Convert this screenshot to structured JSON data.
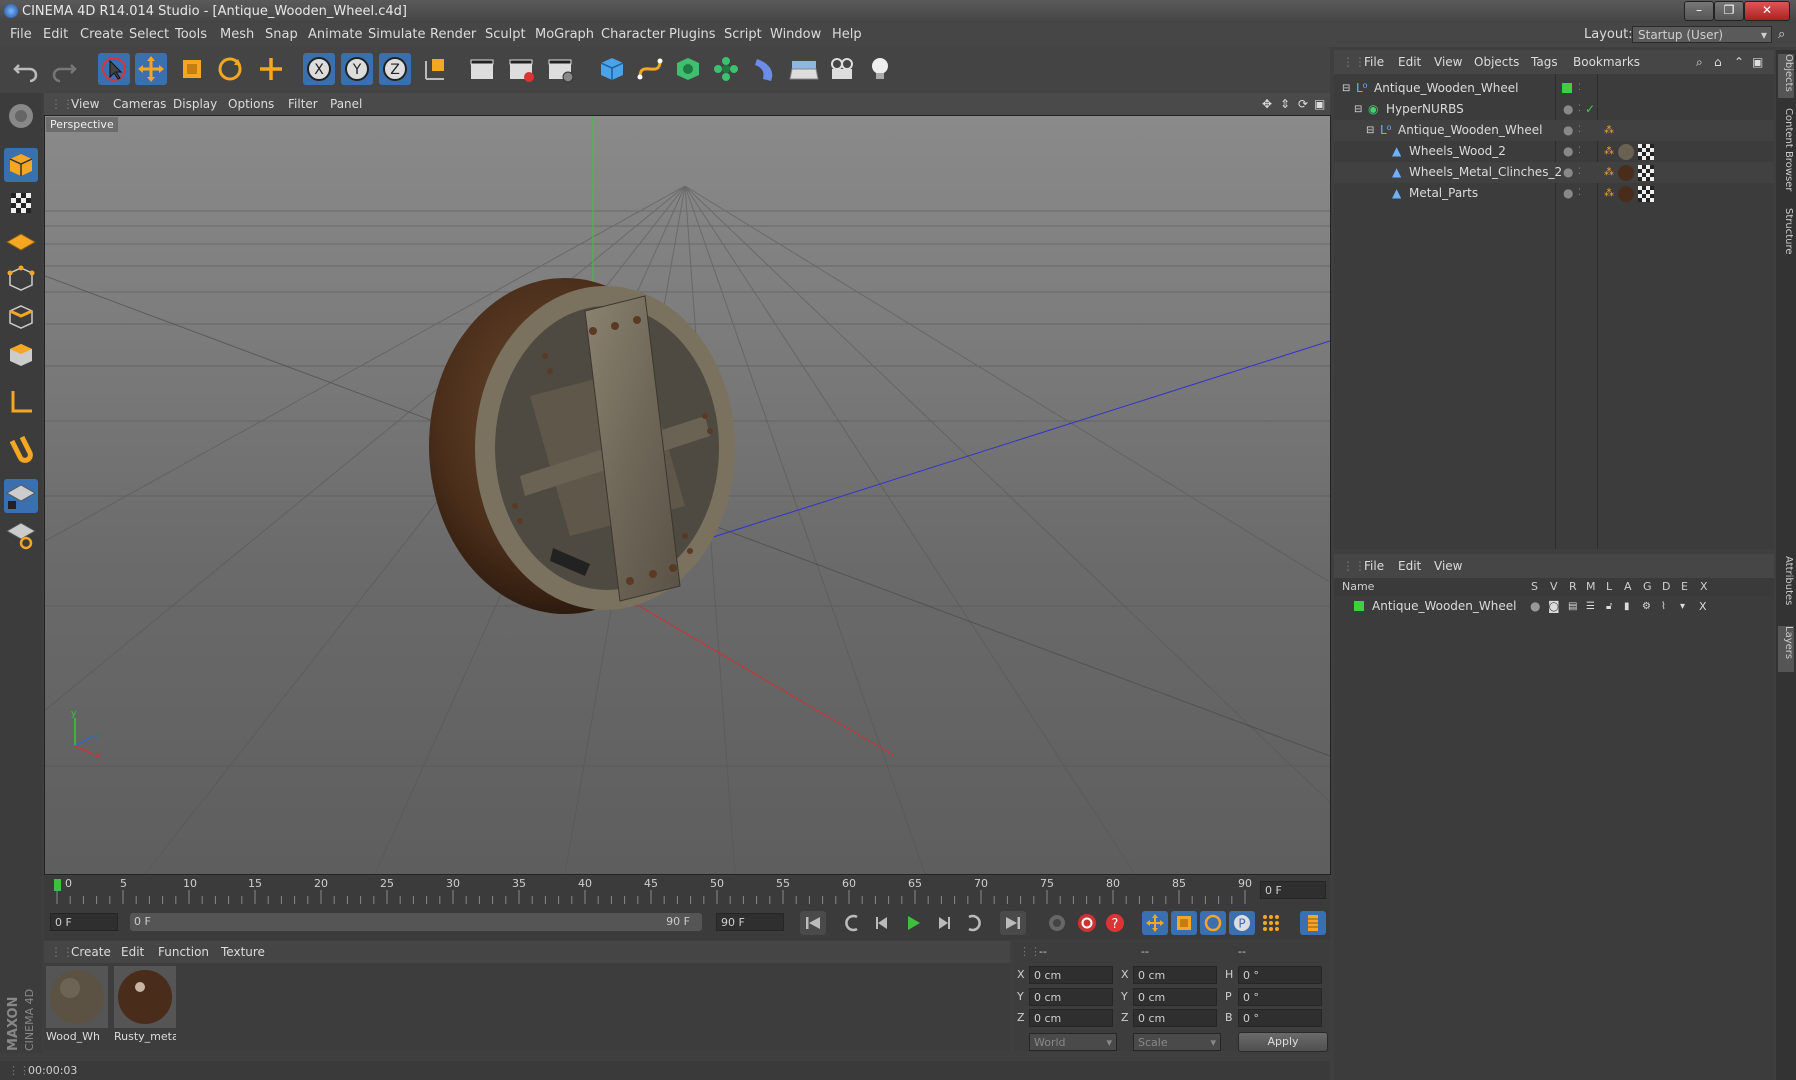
{
  "window": {
    "title": "CINEMA 4D R14.014 Studio - [Antique_Wooden_Wheel.c4d]",
    "layout_label": "Layout:",
    "layout_value": "Startup (User)"
  },
  "menubar": [
    "File",
    "Edit",
    "Create",
    "Select",
    "Tools",
    "Mesh",
    "Snap",
    "Animate",
    "Simulate",
    "Render",
    "Sculpt",
    "MoGraph",
    "Character",
    "Plugins",
    "Script",
    "Window",
    "Help"
  ],
  "viewport": {
    "menu": [
      "View",
      "Cameras",
      "Display",
      "Options",
      "Filter",
      "Panel"
    ],
    "label": "Perspective"
  },
  "timeline": {
    "ticks": [
      "0",
      "5",
      "10",
      "15",
      "20",
      "25",
      "30",
      "35",
      "40",
      "45",
      "50",
      "55",
      "60",
      "65",
      "70",
      "75",
      "80",
      "85",
      "90"
    ],
    "current_frame": "0 F",
    "start_frame": "0 F",
    "range_start": "0 F",
    "range_end": "90 F",
    "end_frame": "90 F"
  },
  "materials": {
    "menu": [
      "Create",
      "Edit",
      "Function",
      "Texture"
    ],
    "items": [
      {
        "name": "Wood_Wh"
      },
      {
        "name": "Rusty_meta"
      }
    ]
  },
  "coords": {
    "headers": [
      "--",
      "--",
      "--"
    ],
    "rows": [
      {
        "a": "X",
        "av": "0 cm",
        "b": "X",
        "bv": "0 cm",
        "c": "H",
        "cv": "0 °"
      },
      {
        "a": "Y",
        "av": "0 cm",
        "b": "Y",
        "bv": "0 cm",
        "c": "P",
        "cv": "0 °"
      },
      {
        "a": "Z",
        "av": "0 cm",
        "b": "Z",
        "bv": "0 cm",
        "c": "B",
        "cv": "0 °"
      }
    ],
    "world": "World",
    "scale": "Scale",
    "apply": "Apply"
  },
  "status": {
    "text": "00:00:03"
  },
  "objects": {
    "menu": [
      "File",
      "Edit",
      "View",
      "Objects",
      "Tags",
      "Bookmarks"
    ],
    "rows": [
      {
        "name": "Antique_Wooden_Wheel",
        "indent": 0
      },
      {
        "name": "HyperNURBS",
        "indent": 1
      },
      {
        "name": "Antique_Wooden_Wheel",
        "indent": 2
      },
      {
        "name": "Wheels_Wood_2",
        "indent": 3
      },
      {
        "name": "Wheels_Metal_Clinches_2",
        "indent": 3
      },
      {
        "name": "Metal_Parts",
        "indent": 3
      }
    ]
  },
  "layers": {
    "menu": [
      "File",
      "Edit",
      "View"
    ],
    "columns": [
      "Name",
      "S",
      "V",
      "R",
      "M",
      "L",
      "A",
      "G",
      "D",
      "E",
      "X"
    ],
    "rows": [
      {
        "name": "Antique_Wooden_Wheel"
      }
    ]
  },
  "side_tabs": [
    "Objects",
    "Content Browser",
    "Structure",
    "Attributes",
    "Layers"
  ],
  "brand": "MAXON CINEMA 4D"
}
